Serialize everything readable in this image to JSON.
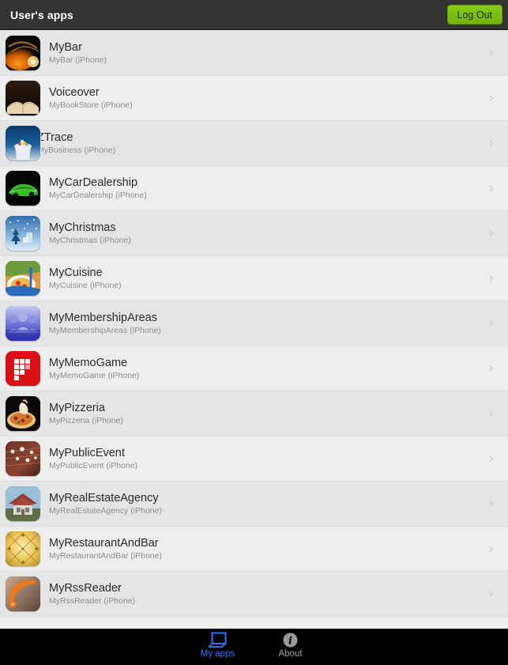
{
  "header": {
    "title": "User's apps",
    "logout_label": "Log Out",
    "background_color": "#333333",
    "logout_color": "#7ac70c"
  },
  "list": {
    "chevron_glyph": "›",
    "items": [
      {
        "title": "MyBar",
        "subtitle": "MyBar (iPhone)",
        "icon": "mybar-icon"
      },
      {
        "title": "Voiceover",
        "subtitle": "MyBookStore (iPhone)",
        "icon": "voiceover-icon"
      },
      {
        "title": "ZTrace",
        "subtitle": "MyBusiness (iPhone)",
        "icon": "ztrace-icon"
      },
      {
        "title": "MyCarDealership",
        "subtitle": "MyCarDealership (iPhone)",
        "icon": "mycardealership-icon"
      },
      {
        "title": "MyChristmas",
        "subtitle": "MyChristmas (iPhone)",
        "icon": "mychristmas-icon"
      },
      {
        "title": "MyCuisine",
        "subtitle": "MyCuisine (iPhone)",
        "icon": "mycuisine-icon"
      },
      {
        "title": "MyMembershipAreas",
        "subtitle": "MyMembershipAreas (iPhone)",
        "icon": "mymembershipareas-icon"
      },
      {
        "title": "MyMemoGame",
        "subtitle": "MyMemoGame (iPhone)",
        "icon": "mymemogame-icon"
      },
      {
        "title": "MyPizzeria",
        "subtitle": "MyPizzeria (iPhone)",
        "icon": "mypizzeria-icon"
      },
      {
        "title": "MyPublicEvent",
        "subtitle": "MyPublicEvent (iPhone)",
        "icon": "mypublicevent-icon"
      },
      {
        "title": "MyRealEstateAgency",
        "subtitle": "MyRealEstateAgency (iPhone)",
        "icon": "myrealestateagency-icon"
      },
      {
        "title": "MyRestaurantAndBar",
        "subtitle": "MyRestaurantAndBar (iPhone)",
        "icon": "myrestaurantandbar-icon"
      },
      {
        "title": "MyRssReader",
        "subtitle": "MyRssReader (iPhone)",
        "icon": "myrssreader-icon"
      }
    ]
  },
  "tabbar": {
    "background_color": "#000000",
    "active_color": "#2c72ef",
    "inactive_color": "#a0a0a0",
    "tabs": [
      {
        "label": "My apps",
        "icon": "windows-icon",
        "active": true
      },
      {
        "label": "About",
        "icon": "info-icon",
        "active": false
      }
    ]
  }
}
